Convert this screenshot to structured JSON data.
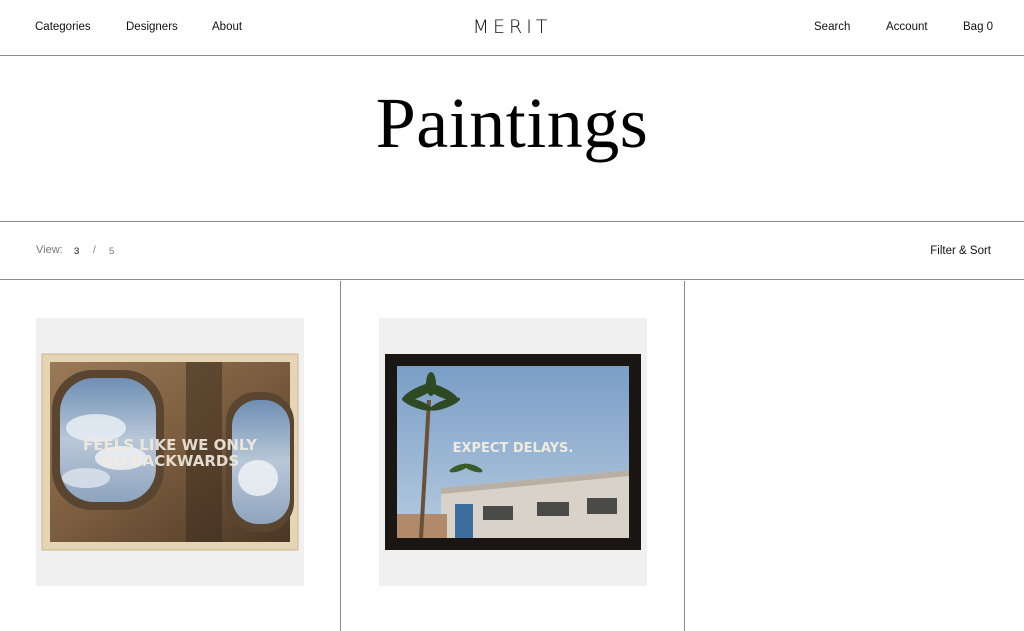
{
  "header": {
    "nav_left": [
      "Categories",
      "Designers",
      "About"
    ],
    "logo": "MERIT",
    "nav_right": {
      "search": "Search",
      "account": "Account",
      "bag": "Bag 0"
    }
  },
  "page": {
    "title": "Paintings"
  },
  "toolbar": {
    "view_label": "View:",
    "view_options": [
      "3",
      "5"
    ],
    "view_selected": "3",
    "separator": "/",
    "filter_sort": "Filter & Sort"
  },
  "products": [
    {
      "painting_text": [
        "FEELS LIKE WE ONLY",
        "GO BACKWARDS"
      ],
      "frame_color": "#e8d8b8"
    },
    {
      "painting_text": [
        "EXPECT DELAYS."
      ],
      "frame_color": "#1a1614"
    }
  ]
}
